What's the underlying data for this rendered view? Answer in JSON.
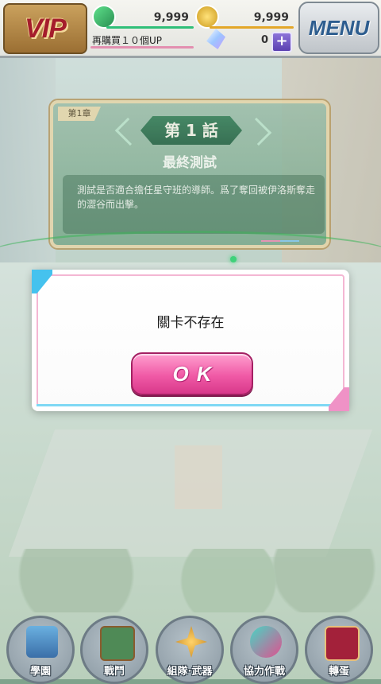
{
  "hud": {
    "vip_label": "VIP",
    "stamina_value": "9,999",
    "coin_value": "9,999",
    "bonus_text": "再購買１０個UP",
    "crystal_value": "0",
    "plus_label": "+",
    "menu_label": "MENU"
  },
  "chapter": {
    "tag": "第1章",
    "episode": "第 1 話",
    "title": "最終測試",
    "description": "測試是否適合擔任星守班的導師。爲了奪回被伊洛斯奪走的澀谷而出擊。"
  },
  "dialog": {
    "message": "關卡不存在",
    "ok_label": "OK"
  },
  "nav": {
    "items": [
      {
        "label": "學園"
      },
      {
        "label": "戰鬥"
      },
      {
        "label": "組隊·武器"
      },
      {
        "label": "協力作戰"
      },
      {
        "label": "轉蛋"
      }
    ]
  },
  "colors": {
    "ok_button": "#f05aa6",
    "dialog_accent_cyan": "#45c2ee",
    "dialog_accent_pink": "#ef92c6",
    "menu_text": "#2d5d8f"
  }
}
